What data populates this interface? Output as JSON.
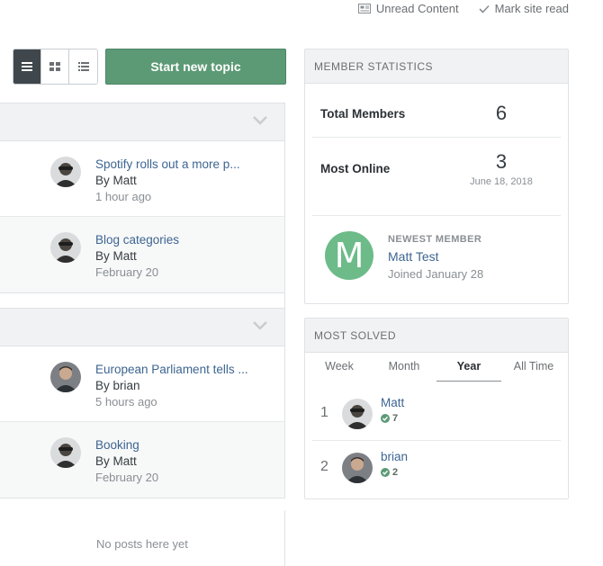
{
  "top_links": {
    "unread": "Unread Content",
    "mark_read": "Mark site read"
  },
  "toolbar": {
    "start_topic": "Start new topic"
  },
  "forum_blocks": [
    {
      "topics": [
        {
          "title": "Spotify rolls out a more p...",
          "by": "By Matt",
          "time": "1 hour ago"
        },
        {
          "title": "Blog categories",
          "by": "By Matt",
          "time": "February 20"
        }
      ]
    },
    {
      "topics": [
        {
          "title": "European Parliament tells ...",
          "by": "By brian",
          "time": "5 hours ago"
        },
        {
          "title": "Booking",
          "by": "By Matt",
          "time": "February 20"
        }
      ]
    }
  ],
  "no_posts": "No posts here yet",
  "member_stats": {
    "header": "MEMBER STATISTICS",
    "total_label": "Total Members",
    "total_value": "6",
    "online_label": "Most Online",
    "online_value": "3",
    "online_date": "June 18, 2018",
    "newest_label": "NEWEST MEMBER",
    "newest_initial": "M",
    "newest_name": "Matt Test",
    "newest_joined": "Joined January 28"
  },
  "most_solved": {
    "header": "MOST SOLVED",
    "tabs": [
      "Week",
      "Month",
      "Year",
      "All Time"
    ],
    "active_tab": "Year",
    "leaders": [
      {
        "rank": "1",
        "name": "Matt",
        "count": "7"
      },
      {
        "rank": "2",
        "name": "brian",
        "count": "2"
      }
    ]
  },
  "colors": {
    "accent_green": "#5c9a76",
    "link_blue": "#3d6591",
    "avatar_green": "#6dbb89"
  }
}
